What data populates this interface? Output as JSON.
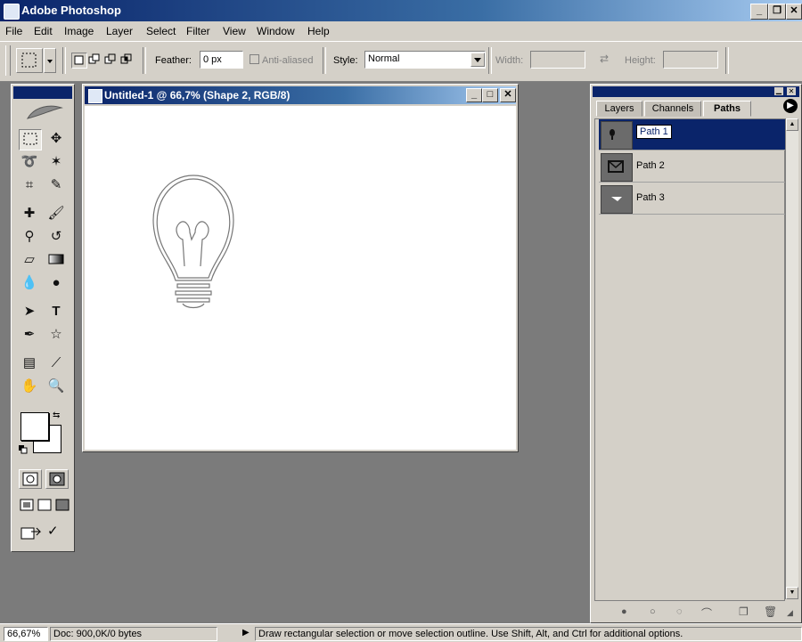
{
  "window": {
    "title": "Adobe Photoshop",
    "btn_min": "_",
    "btn_max": "❐",
    "btn_close": "✕"
  },
  "menu": [
    "File",
    "Edit",
    "Image",
    "Layer",
    "Select",
    "Filter",
    "View",
    "Window",
    "Help"
  ],
  "options": {
    "feather_label": "Feather:",
    "feather_value": "0 px",
    "antialiased_label": "Anti-aliased",
    "style_label": "Style:",
    "style_value": "Normal",
    "width_label": "Width:",
    "height_label": "Height:"
  },
  "document": {
    "title": "Untitled-1 @ 66,7% (Shape 2, RGB/8)",
    "btn_min": "_",
    "btn_max": "□",
    "btn_close": "✕"
  },
  "panel": {
    "tabs": [
      "Layers",
      "Channels",
      "Paths"
    ],
    "active_tab": "Paths",
    "paths": [
      {
        "name": "Path 1",
        "selected": true
      },
      {
        "name": "Path 2",
        "selected": false
      },
      {
        "name": "Path 3",
        "selected": false
      }
    ]
  },
  "status": {
    "zoom": "66,67%",
    "doc": "Doc: 900,0K/0 bytes",
    "hint": "Draw rectangular selection or move selection outline.  Use Shift, Alt, and Ctrl for additional options."
  },
  "colors": {
    "titlebar": "#0a246a",
    "chrome": "#d4d0c8",
    "workspace": "#7b7b7b"
  }
}
